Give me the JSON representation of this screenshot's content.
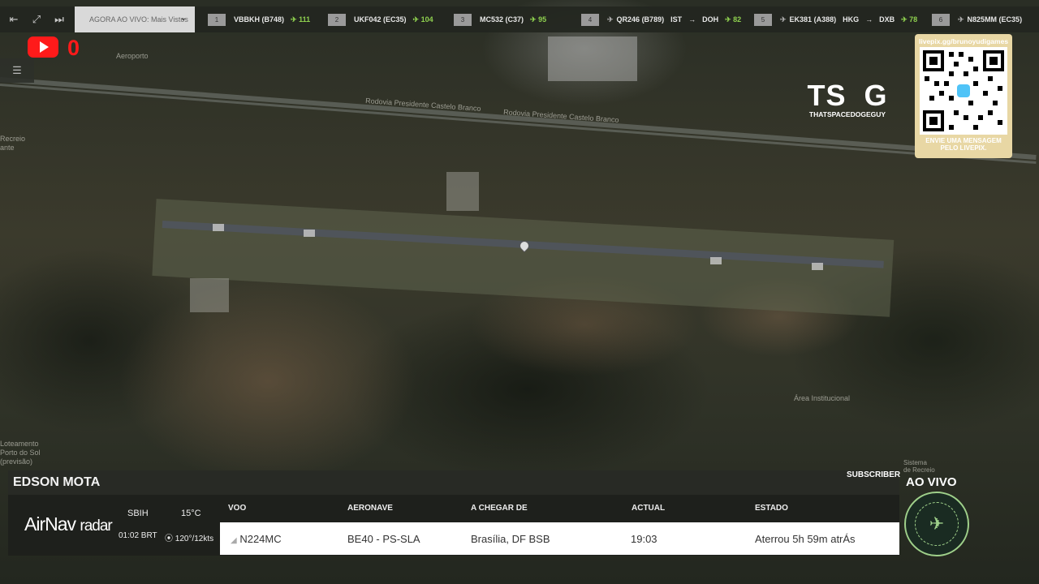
{
  "top_bar": {
    "now_live_label": "AGORA AO VIVO: Mais Vistos",
    "flights": [
      {
        "rank": "1",
        "callsign": "VBBKH (B748)",
        "route_from": "",
        "route_to": "",
        "alt": "111"
      },
      {
        "rank": "2",
        "callsign": "UKF042 (EC35)",
        "route_from": "",
        "route_to": "",
        "alt": "104"
      },
      {
        "rank": "3",
        "callsign": "MC532 (C37)",
        "route_from": "",
        "route_to": "",
        "alt": "95"
      },
      {
        "rank": "4",
        "callsign": "QR246 (B789)",
        "route_from": "IST",
        "route_to": "DOH",
        "alt": "82"
      },
      {
        "rank": "5",
        "callsign": "EK381 (A388)",
        "route_from": "HKG",
        "route_to": "DXB",
        "alt": "78"
      },
      {
        "rank": "6",
        "callsign": "N825MM (EC35)",
        "route_from": "",
        "route_to": "",
        "alt": ""
      }
    ]
  },
  "youtube": {
    "count": "0"
  },
  "logo": {
    "main": "TS  G",
    "sub": "THATSPACEDOGEGUY"
  },
  "qr": {
    "title": "livepix.gg/brunoyudigames",
    "caption": "ENVIE UMA MENSAGEM PELO LIVEPIX."
  },
  "map_labels": {
    "l1": "Aeroporto",
    "l2": "Rodovia Presidente Castelo Branco",
    "l3": "Rodovia Presidente Castelo Branco",
    "l4": "Recreio\nante",
    "l5": "Loteamento\nPorto do Sol\n(previsão)",
    "l6": "Área Institucional",
    "l7": "Sistema\nde Recreio"
  },
  "bottom": {
    "owner": "EDSON MOTA",
    "subscriber": "SUBSCRIBER",
    "ao_vivo": "AO VIVO",
    "brand_main": "AirNav",
    "brand_sub": "radar",
    "airport": "SBIH",
    "local_time": "01:02 BRT",
    "temperature": "15°C",
    "wind": "120°/12kts",
    "headers": {
      "flight": "VOO",
      "aircraft": "AERONAVE",
      "arriving_from": "A CHEGAR DE",
      "actual": "ACTUAL",
      "status": "ESTADO"
    },
    "row": {
      "flight": "N224MC",
      "aircraft": "BE40 - PS-SLA",
      "arriving_from": "Brasília, DF BSB",
      "actual": "19:03",
      "status": "Aterrou 5h 59m atrÁs"
    }
  }
}
